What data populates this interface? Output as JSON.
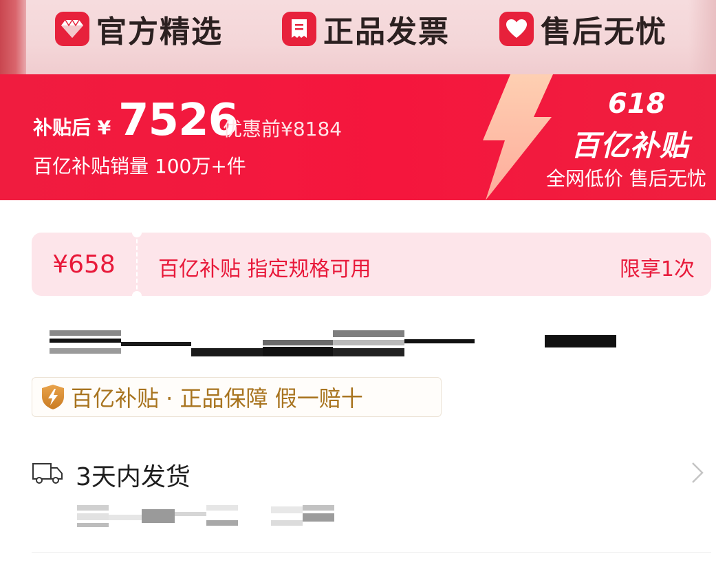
{
  "guarantees": [
    {
      "label": "官方精选",
      "icon": "diamond-icon"
    },
    {
      "label": "正品发票",
      "icon": "invoice-icon"
    },
    {
      "label": "售后无忧",
      "icon": "heart-icon"
    }
  ],
  "banner": {
    "price_prefix": "补贴后 ¥",
    "price": "7526",
    "original_price": "优惠前¥8184",
    "sales": "百亿补贴销量 100万+件",
    "event_number": "618",
    "event_title": "百亿补贴",
    "event_subtitle": "全网低价 售后无忧",
    "colors": {
      "background": "#f5163d",
      "text": "#ffffff"
    }
  },
  "coupon": {
    "amount": "¥658",
    "description": "百亿补贴 指定规格可用",
    "limit": "限享1次",
    "colors": {
      "background": "#fde5ea",
      "text": "#e8193a"
    }
  },
  "subsidy_tag": {
    "text": "百亿补贴 · 正品保障 假一赔十",
    "icon": "shield-lightning-icon",
    "colors": {
      "text": "#a8741f"
    }
  },
  "delivery": {
    "label": "3天内发货",
    "icon": "truck-icon",
    "chevron": "chevron-right-icon"
  }
}
